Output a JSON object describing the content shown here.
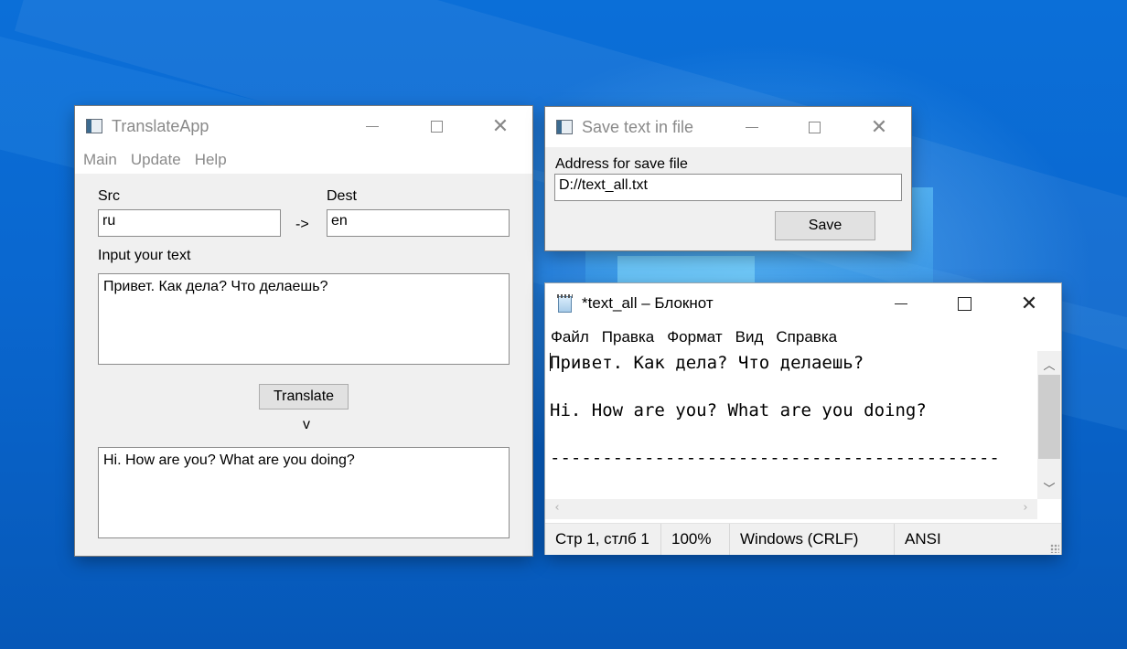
{
  "translate_app": {
    "title": "TranslateApp",
    "menu": [
      "Main",
      "Update",
      "Help"
    ],
    "src_label": "Src",
    "src_value": "ru",
    "arrow": "->",
    "dest_label": "Dest",
    "dest_value": "en",
    "input_label": "Input your text",
    "input_text": "Привет. Как дела? Что делаешь?",
    "translate_button": "Translate",
    "down_marker": "v",
    "output_text": "Hi. How are you? What are you doing?"
  },
  "save_dialog": {
    "title": "Save text in file",
    "address_label": "Address for save file",
    "address_value": "D://text_all.txt",
    "save_button": "Save"
  },
  "notepad": {
    "title": "*text_all – Блокнот",
    "menu": [
      "Файл",
      "Правка",
      "Формат",
      "Вид",
      "Справка"
    ],
    "lines": [
      "Привет. Как дела? Что делаешь?",
      "",
      "Hi. How are you? What are you doing?",
      "",
      "-------------------------------------------"
    ],
    "status": {
      "position": "Стр 1, стлб 1",
      "zoom": "100%",
      "line_ending": "Windows (CRLF)",
      "encoding": "ANSI"
    }
  },
  "icons": {
    "app_icon": "window-icon",
    "notepad_icon": "notepad-icon",
    "minimize": "minimize-icon",
    "maximize": "maximize-icon",
    "close": "close-icon"
  }
}
